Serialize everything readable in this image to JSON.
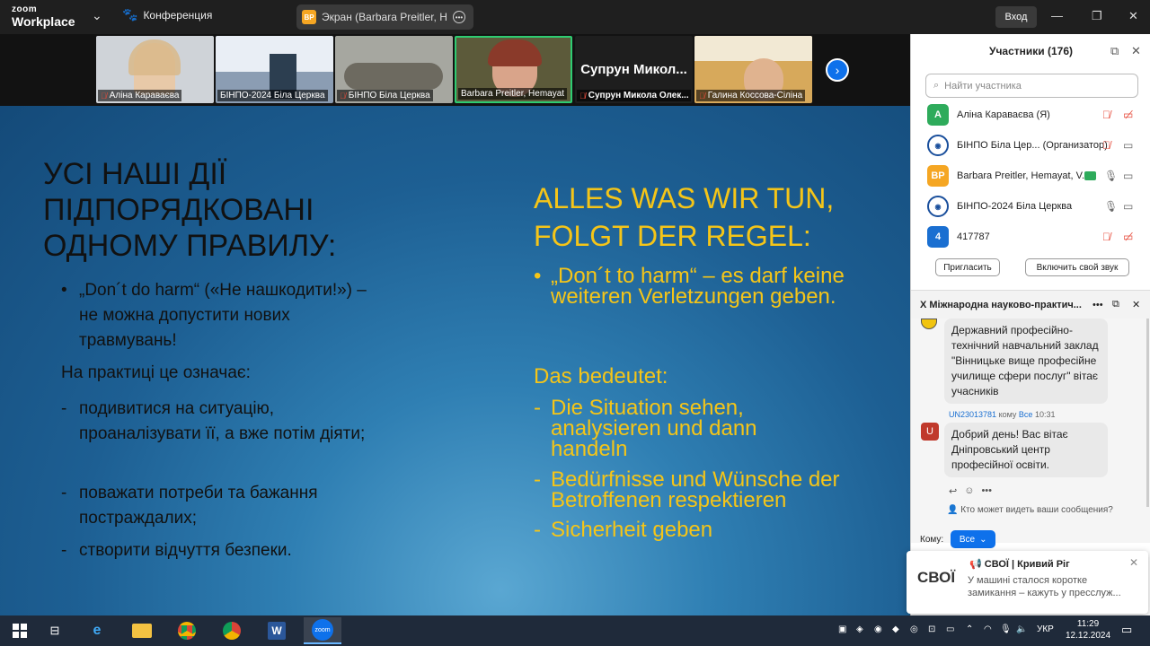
{
  "topbar": {
    "logo_line1": "zoom",
    "logo_line2": "Workplace",
    "meeting_label": "Конференция",
    "screen_share_label": "Экран (Barbara Preitler, Hemaya",
    "screen_share_badge": "BP",
    "sign_in": "Вход"
  },
  "thumbnails": [
    {
      "name": "Аліна Караваєва",
      "bg": "#cfd3d8"
    },
    {
      "name": "БІНПО-2024 Біла Церква",
      "bg": "#8b9db3"
    },
    {
      "name": "БІНПО Біла Церква",
      "bg": "#a6a7a0"
    },
    {
      "name": "Barbara Preitler, Hemayat",
      "bg": "#5c5a3a"
    },
    {
      "name": "Супрун Микола Олек...",
      "tile_text": "Супрун Микол...",
      "bg": "#1e1e1e"
    },
    {
      "name": "Галина Коссова-Сіліна",
      "bg": "#d7a95b"
    }
  ],
  "slide": {
    "uk_title": "УСІ НАШІ ДІЇ ПІДПОРЯДКОВАНІ ОДНОМУ ПРАВИЛУ:",
    "uk_bullet1": "„Don´t do harm“ («Не нашкодити!») – не можна допустити нових травмувань!",
    "uk_sub": "На практиці це означає:",
    "uk_dash1": "подивитися на ситуацію, проаналізувати її, а вже потім діяти;",
    "uk_dash2": "поважати потреби та бажання постраждалих;",
    "uk_dash3": "створити відчуття безпеки.",
    "de_title": "ALLES WAS WIR TUN, FOLGT DER REGEL:",
    "de_bullet1": "„Don´t to harm“ – es darf keine weiteren Verletzungen geben.",
    "de_sub": "Das bedeutet:",
    "de_dash1": "Die Situation sehen, analysieren und dann handeln",
    "de_dash2": "Bedürfnisse und Wünsche der Betroffenen respektieren",
    "de_dash3": "Sicherheit geben"
  },
  "participants": {
    "title": "Участники (176)",
    "search_placeholder": "Найти участника",
    "list": [
      {
        "avatar": "A",
        "avatar_color": "#2eab5b",
        "name": "Аліна Караваєва (Я)",
        "role": ""
      },
      {
        "avatar": "БІНПО",
        "avatar_color": "logo",
        "name": "БІНПО Біла Цер...",
        "role": "(Организатор)"
      },
      {
        "avatar": "BP",
        "avatar_color": "#f5a623",
        "name": "Barbara Preitler, Hemayat, V...",
        "role": ""
      },
      {
        "avatar": "БІНПО",
        "avatar_color": "logo",
        "name": "БІНПО-2024 Біла Церква",
        "role": ""
      },
      {
        "avatar": "4",
        "avatar_color": "#1a6fd1",
        "name": "417787",
        "role": ""
      }
    ],
    "invite": "Пригласить",
    "unmute": "Включить свой звук"
  },
  "chat": {
    "title": "Х Міжнародна науково-практич...",
    "msg1": "Державний професійно-технічний навчальний заклад \"Вінницьке вище професійне училище сфери послуг\" вітає учасників",
    "msg2_sender": "UN23013781",
    "msg2_to_label": "кому",
    "msg2_to": "Все",
    "msg2_time": "10:31",
    "msg2_avatar": "U",
    "msg2": "Добрий день! Вас вітає Дніпровський центр професійної освіти.",
    "who_can_see": "Кто может видеть ваши сообщения?",
    "to_label": "Кому:",
    "to_value": "Все"
  },
  "toast": {
    "logo": "СВОЇ",
    "title": "СВОЇ | Кривий Ріг",
    "body": "У машині сталося коротке замикання – кажуть у пресслуж..."
  },
  "taskbar": {
    "lang": "УКР",
    "time": "11:29",
    "date": "12.12.2024"
  }
}
